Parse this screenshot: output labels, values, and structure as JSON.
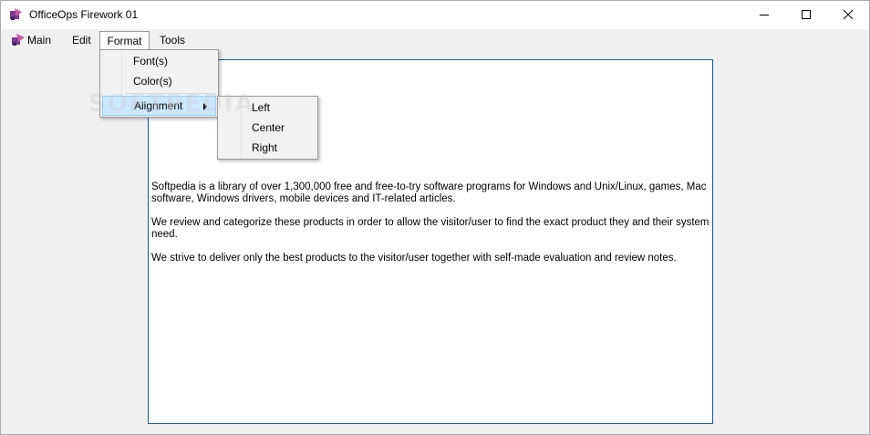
{
  "window": {
    "title": "OfficeOps Firework 01",
    "controls": {
      "minimize": "minimize-icon",
      "maximize": "maximize-icon",
      "close": "close-icon"
    }
  },
  "menubar": {
    "items": [
      {
        "label": "Main",
        "icon": "app-logo-icon"
      },
      {
        "label": "Edit"
      },
      {
        "label": "Format",
        "active": true
      },
      {
        "label": "Tools"
      }
    ]
  },
  "format_menu": {
    "items": [
      {
        "label": "Font(s)"
      },
      {
        "label": "Color(s)"
      },
      {
        "label": "Alignment",
        "submenu": true,
        "highlighted": true
      }
    ]
  },
  "alignment_submenu": {
    "items": [
      {
        "label": "Left"
      },
      {
        "label": "Center"
      },
      {
        "label": "Right"
      }
    ]
  },
  "document": {
    "paragraphs": [
      "Softpedia is a library of over 1,300,000 free and free-to-try software programs for Windows and Unix/Linux, games, Mac software, Windows drivers, mobile devices and IT-related articles.",
      "We review and categorize these products in order to allow the visitor/user to find the exact product they and their system need.",
      "We strive to deliver only the best products to the visitor/user together with self-made evaluation and review notes."
    ]
  },
  "watermark": "SOFTPEDIA",
  "colors": {
    "document_border": "#1e5a9a",
    "menu_highlight": "#cce8ff",
    "menu_highlight_border": "#99d1ff",
    "chrome": "#f0f0f0"
  }
}
